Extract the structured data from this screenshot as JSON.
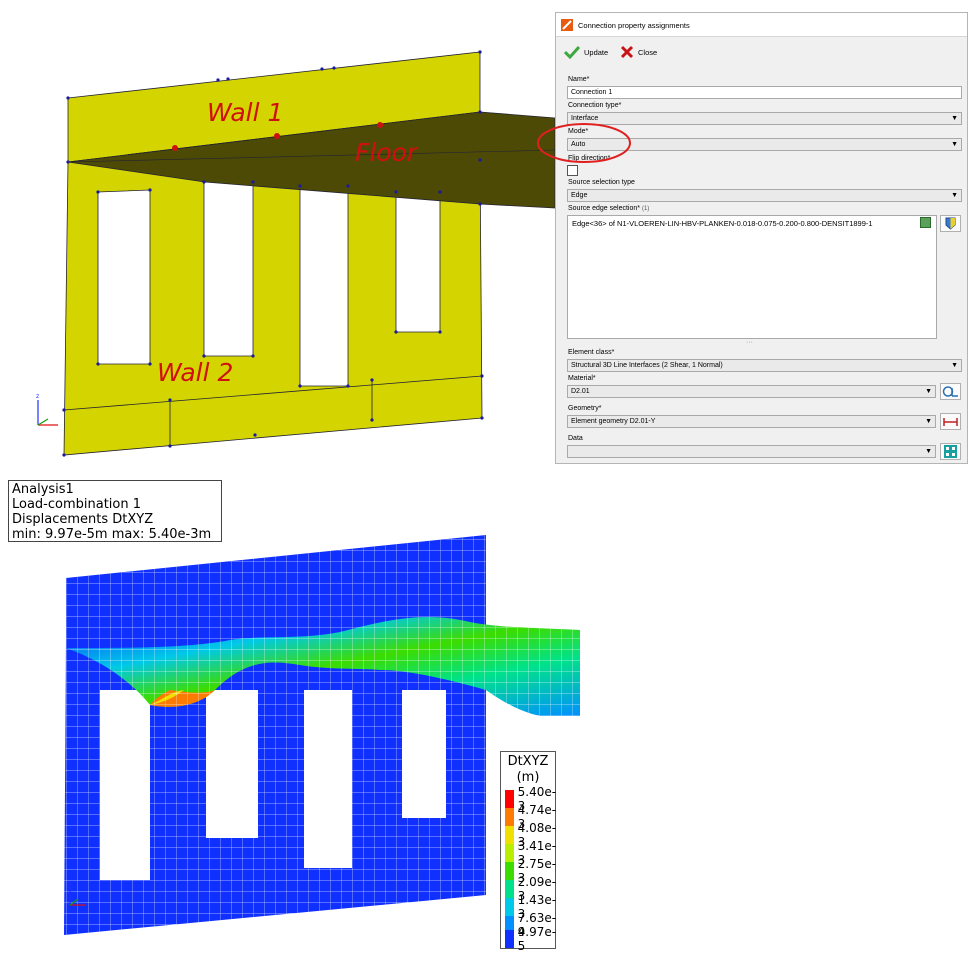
{
  "geometry_view": {
    "labels": {
      "wall1": "Wall 1",
      "floor": "Floor",
      "wall2": "Wall 2"
    }
  },
  "dialog": {
    "title": "Connection property assignments",
    "toolbar": {
      "update": "Update",
      "close": "Close"
    },
    "name": {
      "label": "Name*",
      "value": "Connection 1"
    },
    "connection_type": {
      "label": "Connection type*",
      "value": "Interface"
    },
    "mode": {
      "label": "Mode*",
      "value": "Auto"
    },
    "flip_direction": {
      "label": "Flip direction*",
      "checked": false
    },
    "source_selection_type": {
      "label": "Source selection type",
      "value": "Edge"
    },
    "source_edge_selection": {
      "label": "Source edge selection*",
      "count": "(1)",
      "value": "Edge<36> of N1-VLOEREN-LIN-HBV-PLANKEN-0.018-0.075-0.200-0.800-DENSIT1899-1"
    },
    "element_class": {
      "label": "Element class*",
      "value": "Structural 3D Line Interfaces (2 Shear, 1 Normal)"
    },
    "material": {
      "label": "Material*",
      "value": "D2.01"
    },
    "geometry": {
      "label": "Geometry*",
      "value": "Element geometry D2.01-Y"
    },
    "data": {
      "label": "Data",
      "value": ""
    },
    "highlight_color": "#e02020"
  },
  "results": {
    "info": {
      "line1": "Analysis1",
      "line2": "Load-combination 1",
      "line3": "Displacements DtXYZ",
      "line4": "min:  9.97e-5m max:  5.40e-3m"
    },
    "legend": {
      "title": "DtXYZ",
      "unit": "(m)",
      "entries": [
        {
          "value": "5.40e-3",
          "color": "#ff0000"
        },
        {
          "value": "4.74e-3",
          "color": "#ff7a00"
        },
        {
          "value": "4.08e-3",
          "color": "#f0e000"
        },
        {
          "value": "3.41e-3",
          "color": "#b8ee00"
        },
        {
          "value": "2.75e-3",
          "color": "#3cdc00"
        },
        {
          "value": "2.09e-3",
          "color": "#00e28a"
        },
        {
          "value": "1.43e-3",
          "color": "#00c8e8"
        },
        {
          "value": "7.63e-4",
          "color": "#0090ff"
        },
        {
          "value": "9.97e-5",
          "color": "#1030ff"
        }
      ]
    }
  }
}
